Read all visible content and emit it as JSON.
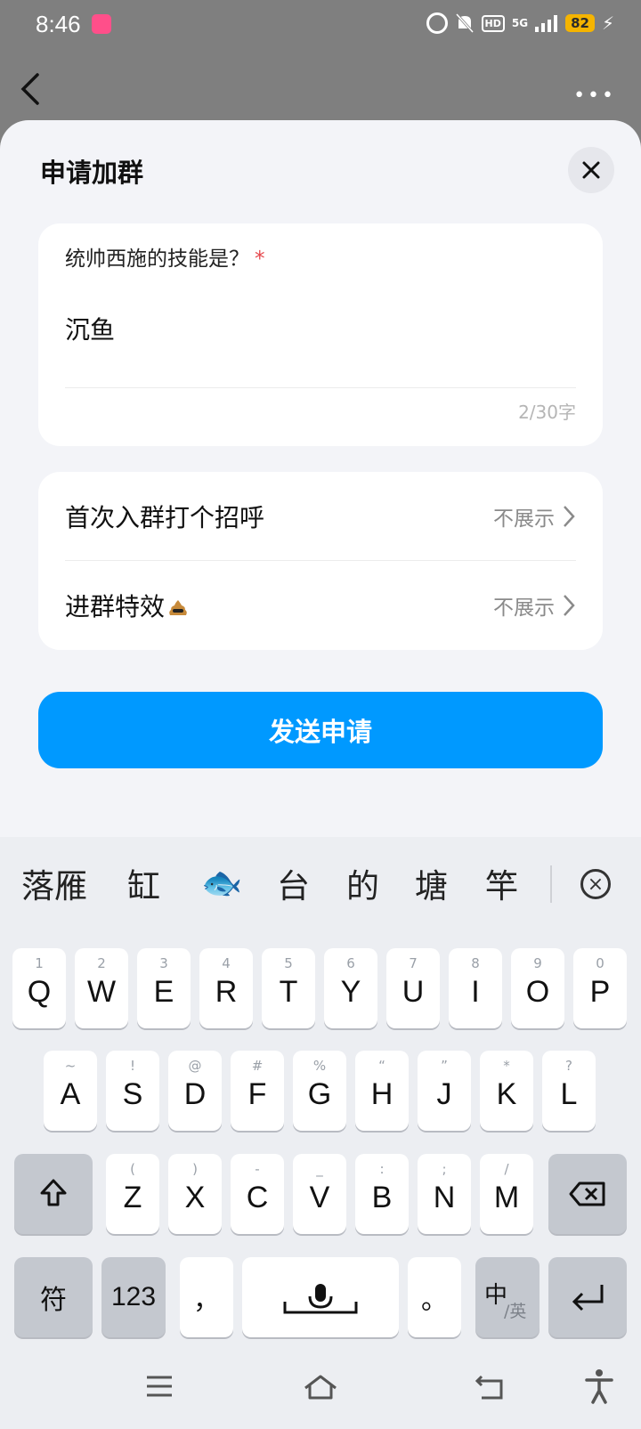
{
  "status_bar": {
    "time": "8:46",
    "network": "5G",
    "hd": "HD",
    "battery": "82"
  },
  "nav": {
    "more_label": "•••"
  },
  "sheet": {
    "title": "申请加群",
    "question_label": "统帅西施的技能是？",
    "required_mark": "*",
    "answer_value": "沉鱼",
    "char_count": "2/30字",
    "rows": [
      {
        "label": "首次入群打个招呼",
        "value": "不展示"
      },
      {
        "label": "进群特效",
        "value": "不展示"
      }
    ],
    "send_button": "发送申请"
  },
  "keyboard": {
    "candidates": [
      "落雁",
      "缸",
      "🐟",
      "台",
      "的",
      "塘",
      "竿"
    ],
    "row1": [
      {
        "hint": "1",
        "key": "Q"
      },
      {
        "hint": "2",
        "key": "W"
      },
      {
        "hint": "3",
        "key": "E"
      },
      {
        "hint": "4",
        "key": "R"
      },
      {
        "hint": "5",
        "key": "T"
      },
      {
        "hint": "6",
        "key": "Y"
      },
      {
        "hint": "7",
        "key": "U"
      },
      {
        "hint": "8",
        "key": "I"
      },
      {
        "hint": "9",
        "key": "O"
      },
      {
        "hint": "0",
        "key": "P"
      }
    ],
    "row2": [
      {
        "hint": "~",
        "key": "A"
      },
      {
        "hint": "!",
        "key": "S"
      },
      {
        "hint": "@",
        "key": "D"
      },
      {
        "hint": "#",
        "key": "F"
      },
      {
        "hint": "%",
        "key": "G"
      },
      {
        "hint": "“",
        "key": "H"
      },
      {
        "hint": "”",
        "key": "J"
      },
      {
        "hint": "*",
        "key": "K"
      },
      {
        "hint": "?",
        "key": "L"
      }
    ],
    "row3": [
      {
        "hint": "(",
        "key": "Z"
      },
      {
        "hint": ")",
        "key": "X"
      },
      {
        "hint": "-",
        "key": "C"
      },
      {
        "hint": "_",
        "key": "V"
      },
      {
        "hint": ":",
        "key": "B"
      },
      {
        "hint": ";",
        "key": "N"
      },
      {
        "hint": "/",
        "key": "M"
      }
    ],
    "symbols_key": "符",
    "numbers_key": "123",
    "comma_key": "，",
    "period_key": "。",
    "lang_key_main": "中",
    "lang_key_sub": "/英"
  }
}
